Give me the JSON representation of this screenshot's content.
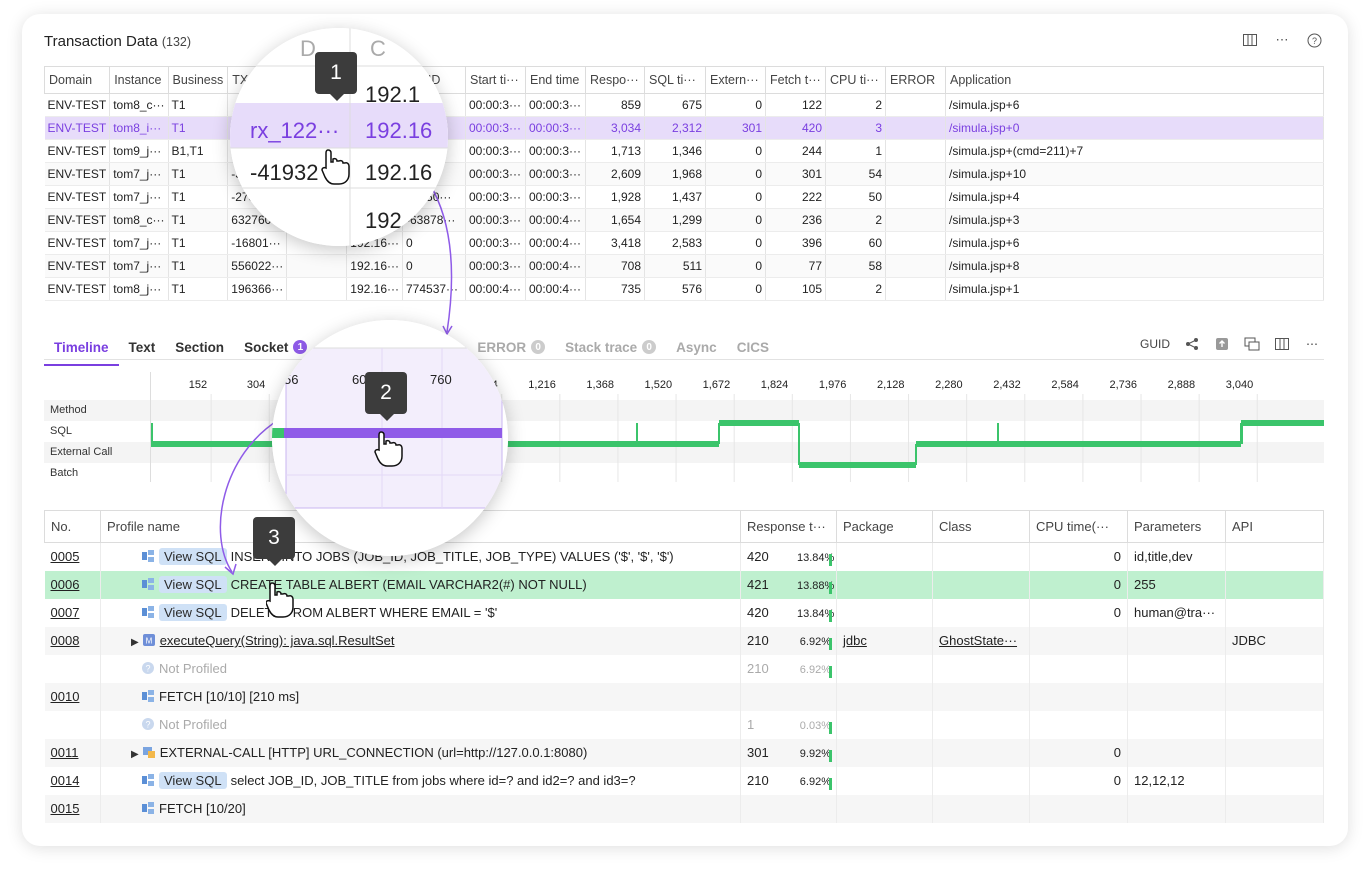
{
  "header": {
    "title": "Transaction Data",
    "count": "(132)"
  },
  "header_icons": [
    "columns-icon",
    "more-icon",
    "help-icon"
  ],
  "top_table": {
    "columns": [
      "Domain",
      "Instance",
      "Business",
      "TX",
      "",
      "",
      "ent ID",
      "Start ti···",
      "End time",
      "Respo···",
      "SQL ti···",
      "Extern···",
      "Fetch t···",
      "CPU ti···",
      "ERROR",
      "Application"
    ],
    "rows": [
      [
        "ENV-TEST",
        "tom8_c···",
        "T1",
        "",
        "",
        "",
        "32···",
        "00:00:3···",
        "00:00:3···",
        "859",
        "675",
        "0",
        "122",
        "2",
        "",
        "/simula.jsp+6"
      ],
      [
        "ENV-TEST",
        "tom8_i···",
        "T1",
        "",
        "",
        "",
        "2···",
        "00:00:3···",
        "00:00:3···",
        "3,034",
        "2,312",
        "301",
        "420",
        "3",
        "",
        "/simula.jsp+0"
      ],
      [
        "ENV-TEST",
        "tom9_j···",
        "B1,T1",
        "",
        "",
        "",
        "7···",
        "00:00:3···",
        "00:00:3···",
        "1,713",
        "1,346",
        "0",
        "244",
        "1",
        "",
        "/simula.jsp+(cmd=211)+7"
      ],
      [
        "ENV-TEST",
        "tom7_j···",
        "T1",
        "-3",
        "",
        "",
        "",
        "00:00:3···",
        "00:00:3···",
        "2,609",
        "1,968",
        "0",
        "301",
        "54",
        "",
        "/simula.jsp+10"
      ],
      [
        "ENV-TEST",
        "tom7_j···",
        "T1",
        "-273·",
        "",
        "",
        "01250···",
        "00:00:3···",
        "00:00:3···",
        "1,928",
        "1,437",
        "0",
        "222",
        "50",
        "",
        "/simula.jsp+4"
      ],
      [
        "ENV-TEST",
        "tom8_c···",
        "T1",
        "632760···",
        "",
        "",
        "-63878···",
        "00:00:3···",
        "00:00:4···",
        "1,654",
        "1,299",
        "0",
        "236",
        "2",
        "",
        "/simula.jsp+3"
      ],
      [
        "ENV-TEST",
        "tom7_j···",
        "T1",
        "-16801···",
        "",
        "192.16···",
        "0",
        "00:00:3···",
        "00:00:4···",
        "3,418",
        "2,583",
        "0",
        "396",
        "60",
        "",
        "/simula.jsp+6"
      ],
      [
        "ENV-TEST",
        "tom7_j···",
        "T1",
        "556022···",
        "",
        "192.16···",
        "0",
        "00:00:3···",
        "00:00:4···",
        "708",
        "511",
        "0",
        "77",
        "58",
        "",
        "/simula.jsp+8"
      ],
      [
        "ENV-TEST",
        "tom8_j···",
        "T1",
        "196366···",
        "",
        "192.16···",
        "774537···",
        "00:00:4···",
        "00:00:4···",
        "735",
        "576",
        "0",
        "105",
        "2",
        "",
        "/simula.jsp+1"
      ]
    ],
    "selected_row": 1
  },
  "tabs": [
    {
      "label": "Timeline",
      "active": true
    },
    {
      "label": "Text"
    },
    {
      "label": "Section"
    },
    {
      "label": "Socket",
      "badge": "1"
    },
    {
      "label": "ERROR",
      "badge": "0",
      "muted": true
    },
    {
      "label": "Stack trace",
      "badge": "0",
      "muted": true
    },
    {
      "label": "Async",
      "muted": true
    },
    {
      "label": "CICS",
      "muted": true
    }
  ],
  "toolbar": {
    "guid_label": "GUID",
    "icons": [
      "share-icon",
      "export-icon",
      "compare-icon",
      "columns-icon",
      "more-icon"
    ]
  },
  "timeline": {
    "ticks": [
      "152",
      "304",
      "56",
      "608",
      "760",
      "1,064",
      "1,216",
      "1,368",
      "1,520",
      "1,672",
      "1,824",
      "1,976",
      "2,128",
      "2,280",
      "2,432",
      "2,584",
      "2,736",
      "2,888",
      "3,040"
    ],
    "rows": [
      "Method",
      "SQL",
      "External Call",
      "Batch"
    ],
    "max": 3034,
    "color": "#3bc46b",
    "highlight_color": "#8f5be8"
  },
  "profile_table": {
    "columns": [
      "No.",
      "Profile name",
      "Response t···",
      "Package",
      "Class",
      "CPU time(···",
      "Parameters",
      "API"
    ],
    "rows": [
      {
        "no": "0005",
        "icon": "sql-icon",
        "viewsql": "View SQL",
        "name": "INSERT INTO JOBS (JOB_ID, JOB_TITLE, JOB_TYPE) VALUES ('$', '$', '$')",
        "resp": "420",
        "pct": "13.84%",
        "pkg": "",
        "cls": "",
        "cpu": "0",
        "params": "id,title,dev",
        "api": ""
      },
      {
        "no": "0006",
        "icon": "sql-icon",
        "viewsql": "View SQL",
        "name": "CREATE TABLE ALBERT (EMAIL VARCHAR2(#) NOT NULL)",
        "resp": "421",
        "pct": "13.88%",
        "pkg": "",
        "cls": "",
        "cpu": "0",
        "params": "255",
        "api": "",
        "highlight": true
      },
      {
        "no": "0007",
        "icon": "sql-icon",
        "viewsql": "View SQL",
        "name": "DELETE FROM ALBERT WHERE EMAIL = '$'",
        "resp": "420",
        "pct": "13.84%",
        "pkg": "",
        "cls": "",
        "cpu": "0",
        "params": "human@tra···",
        "api": ""
      },
      {
        "no": "0008",
        "icon": "method-icon",
        "expand": true,
        "name": "executeQuery(String): java.sql.ResultSet",
        "link": true,
        "resp": "210",
        "pct": "6.92%",
        "pkg": "jdbc",
        "cls": "GhostState···",
        "cpu": "",
        "params": "",
        "api": "JDBC"
      },
      {
        "no": "",
        "icon": "info-icon",
        "name": "Not Profiled",
        "greyed": true,
        "resp": "210",
        "pct": "6.92%",
        "pkg": "",
        "cls": "",
        "cpu": "",
        "params": "",
        "api": ""
      },
      {
        "no": "0010",
        "icon": "sql-icon",
        "name": "FETCH [10/10] [210 ms]",
        "resp": "",
        "pct": "",
        "pkg": "",
        "cls": "",
        "cpu": "",
        "params": "",
        "api": ""
      },
      {
        "no": "",
        "icon": "info-icon",
        "name": "Not Profiled",
        "greyed": true,
        "resp": "1",
        "pct": "0.03%",
        "pkg": "",
        "cls": "",
        "cpu": "",
        "params": "",
        "api": ""
      },
      {
        "no": "0011",
        "icon": "external-icon",
        "expand": true,
        "name": "EXTERNAL-CALL [HTTP] URL_CONNECTION (url=http://127.0.0.1:8080)",
        "resp": "301",
        "pct": "9.92%",
        "pkg": "",
        "cls": "",
        "cpu": "0",
        "params": "",
        "api": ""
      },
      {
        "no": "0014",
        "icon": "sql-icon",
        "viewsql": "View SQL",
        "name": "select JOB_ID, JOB_TITLE from jobs where id=? and id2=? and id3=?",
        "resp": "210",
        "pct": "6.92%",
        "pkg": "",
        "cls": "",
        "cpu": "0",
        "params": "12,12,12",
        "api": ""
      },
      {
        "no": "0015",
        "icon": "sql-icon",
        "name": "FETCH [10/20]",
        "resp": "",
        "pct": "",
        "pkg": "",
        "cls": "",
        "cpu": "",
        "params": "",
        "api": ""
      }
    ]
  },
  "magnifier1": {
    "cells": [
      "D",
      "C",
      "192.1",
      "rx_122···",
      "192.16",
      "-41932",
      "192.16",
      "192"
    ]
  },
  "magnifier2": {
    "ticks": [
      "56",
      "608",
      "760"
    ]
  },
  "steps": [
    "1",
    "2",
    "3"
  ]
}
